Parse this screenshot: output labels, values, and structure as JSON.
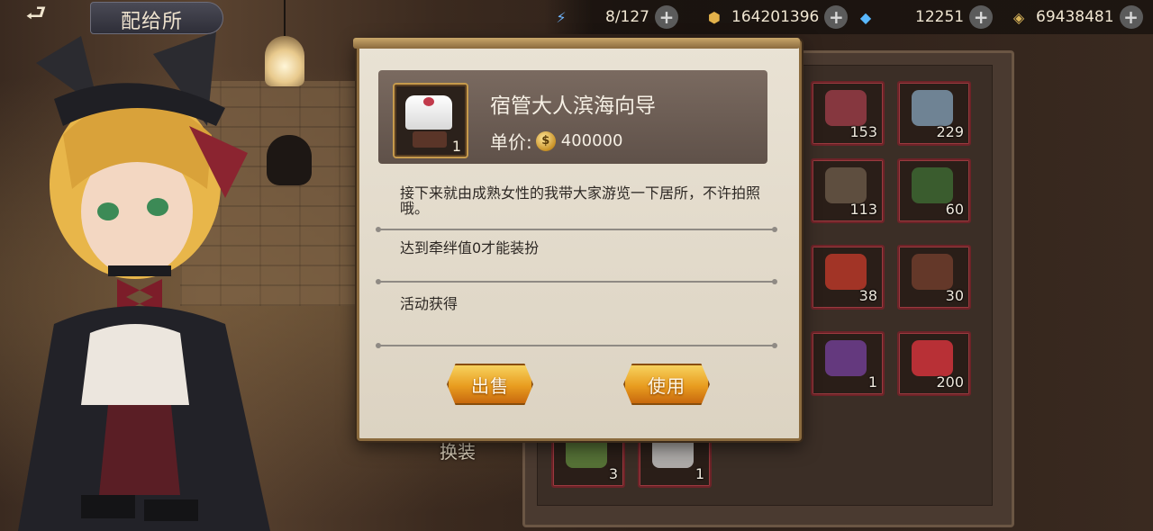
{
  "header": {
    "back_label": "⮐",
    "title": "配给所"
  },
  "resources": [
    {
      "icon": "lightning-icon",
      "value": "8/127",
      "color": "#6fb6ff"
    },
    {
      "icon": "gold-coin-icon",
      "value": "164201396",
      "color": "#e2b14a"
    },
    {
      "icon": "gem-card-icon",
      "value": "12251",
      "color": "#59b8ff"
    },
    {
      "icon": "crystal-icon",
      "value": "69438481",
      "color": "#d9b45a"
    }
  ],
  "inventory": {
    "swap_label": "换装",
    "items": [
      {
        "name": "heart-necklace",
        "count": "153",
        "color": "#c4485a"
      },
      {
        "name": "snow-globe",
        "count": "229",
        "color": "#9fc7e8"
      },
      {
        "name": "treasure-chest",
        "count": "113",
        "color": "#6b5a4a"
      },
      {
        "name": "bonsai-tree",
        "count": "60",
        "color": "#3f6b34"
      },
      {
        "name": "red-bird",
        "count": "38",
        "color": "#c0392b"
      },
      {
        "name": "lock-diary",
        "count": "30",
        "color": "#6a3b2b"
      },
      {
        "name": "purple-bag",
        "count": "1",
        "color": "#6a3c8a"
      },
      {
        "name": "red-teacup",
        "count": "200",
        "color": "#c8323a"
      },
      {
        "name": "rice-dumpling",
        "count": "3",
        "color": "#5a7a3a"
      },
      {
        "name": "white-outfit",
        "count": "1",
        "color": "#e6e6e6"
      }
    ]
  },
  "dialog": {
    "item_name": "宿管大人滨海向导",
    "item_qty": "1",
    "price_label": "单价:",
    "coin_symbol": "$",
    "price_value": "400000",
    "description": "接下来就由成熟女性的我带大家游览一下居所，不许拍照哦。",
    "requirement": "达到牵绊值0才能装扮",
    "source": "活动获得",
    "sell_label": "出售",
    "use_label": "使用"
  }
}
